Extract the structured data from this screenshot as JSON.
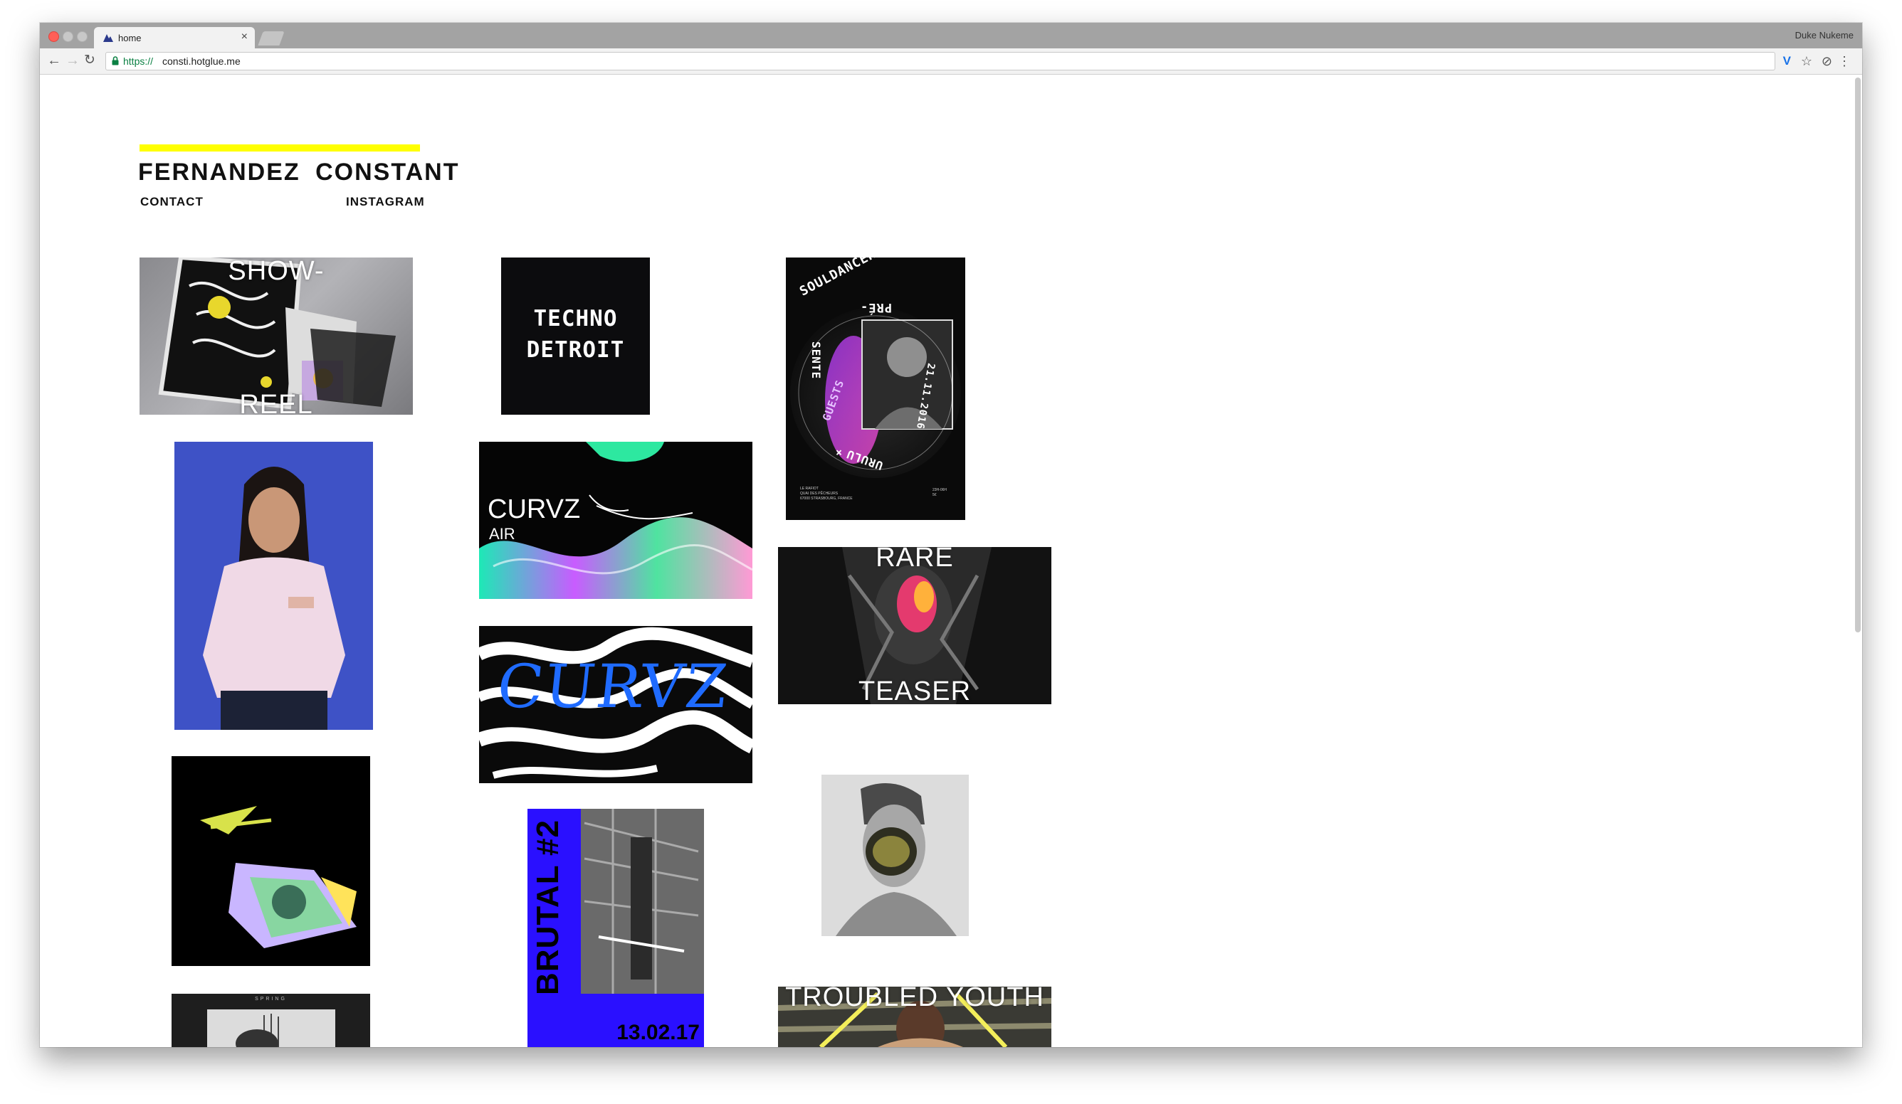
{
  "browser": {
    "tab_title": "home",
    "tab_close": "×",
    "profile_name": "Duke Nukeme",
    "url_scheme": "https://",
    "url_rest": "consti.hotglue.me",
    "back_glyph": "←",
    "forward_glyph": "→",
    "reload_glyph": "↻",
    "vivaldi_glyph": "V",
    "star_glyph": "☆",
    "ext_glyph": "⊘",
    "menu_glyph": "⋮"
  },
  "site": {
    "title": "FERNANDEZ CONSTANT",
    "nav": {
      "contact": "CONTACT",
      "instagram": "INSTAGRAM"
    },
    "accent_color": "#ffff00"
  },
  "tiles": {
    "showreel": {
      "top": "SHOW-",
      "bottom": "REEL"
    },
    "techno": {
      "line1": "TECHNO",
      "line2": "DETROIT"
    },
    "souldancer": {
      "name": "SOULDANCER",
      "pre": "PRÉ-",
      "sente": "SENTE",
      "guests": "GUESTS",
      "urulu": "URULU",
      "date": "21.11.2016",
      "x_mark": "×",
      "venue": "LE RAFIOT\nQUAI DES PÊCHEURS\n67000 STRASBOURG, FRANCE",
      "times": "23H-06H\n5€"
    },
    "curvz_air": {
      "title": "CURVZ",
      "sub": "AIR"
    },
    "curvz": {
      "title": "CURVZ"
    },
    "rare_teaser": {
      "top": "RARE",
      "bottom": "TEASER"
    },
    "brutal": {
      "title": "BRUTAL #2",
      "date": "13.02.17"
    },
    "troubled_youth": {
      "title": "TROUBLED YOUTH"
    },
    "fashion_small": {
      "label": "SPRING"
    }
  },
  "icons": {
    "tab_favicon": "hotglue-icon",
    "lock": "lock-icon"
  }
}
